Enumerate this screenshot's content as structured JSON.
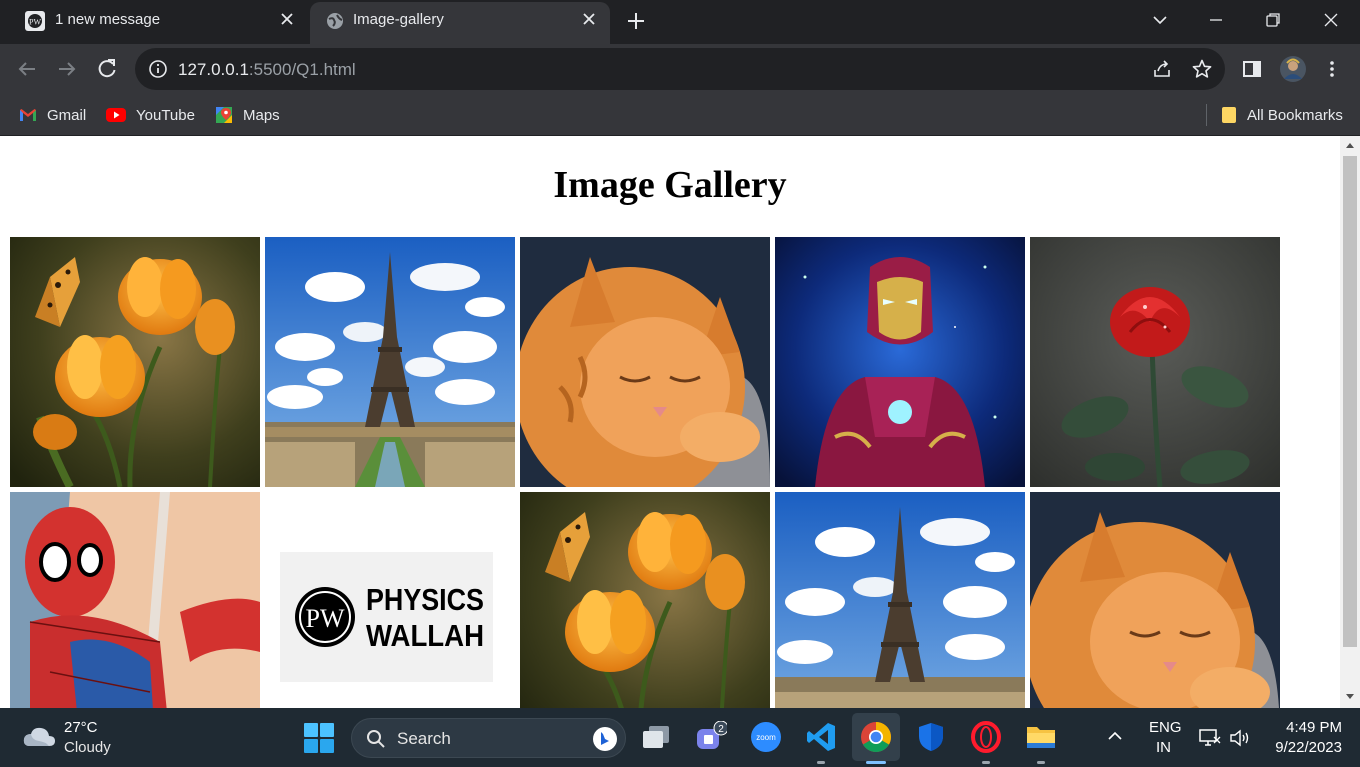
{
  "browser": {
    "tabs": [
      {
        "title": "1 new message",
        "favicon": "pw-logo-icon",
        "active": false
      },
      {
        "title": "Image-gallery",
        "favicon": "globe-icon",
        "active": true
      }
    ],
    "url_host": "127.0.0.1",
    "url_rest": ":5500/Q1.html",
    "bookmarks": [
      {
        "label": "Gmail",
        "icon": "gmail-icon"
      },
      {
        "label": "YouTube",
        "icon": "youtube-icon"
      },
      {
        "label": "Maps",
        "icon": "maps-icon"
      }
    ],
    "all_bookmarks_label": "All Bookmarks"
  },
  "page": {
    "title": "Image Gallery",
    "images": [
      {
        "subject": "butterfly-flowers-image"
      },
      {
        "subject": "eiffel-tower-image"
      },
      {
        "subject": "sleeping-cat-image"
      },
      {
        "subject": "iron-man-image"
      },
      {
        "subject": "red-rose-image"
      },
      {
        "subject": "spider-man-image"
      },
      {
        "subject": "physics-wallah-logo-image",
        "logo_initials": "PW",
        "logo_text_1": "PHYSICS",
        "logo_text_2": "WALLAH"
      },
      {
        "subject": "butterfly-flowers-image"
      },
      {
        "subject": "eiffel-tower-image"
      },
      {
        "subject": "sleeping-cat-image"
      }
    ]
  },
  "taskbar": {
    "weather_temp": "27°C",
    "weather_desc": "Cloudy",
    "search_label": "Search",
    "teams_badge": "2",
    "zoom_label": "zoom",
    "lang_1": "ENG",
    "lang_2": "IN",
    "time": "4:49 PM",
    "date": "9/22/2023"
  },
  "colors": {
    "tabstrip": "#202124",
    "toolbar": "#35363a",
    "taskbar": "#1f2a33",
    "page_bg": "#ffffff"
  }
}
